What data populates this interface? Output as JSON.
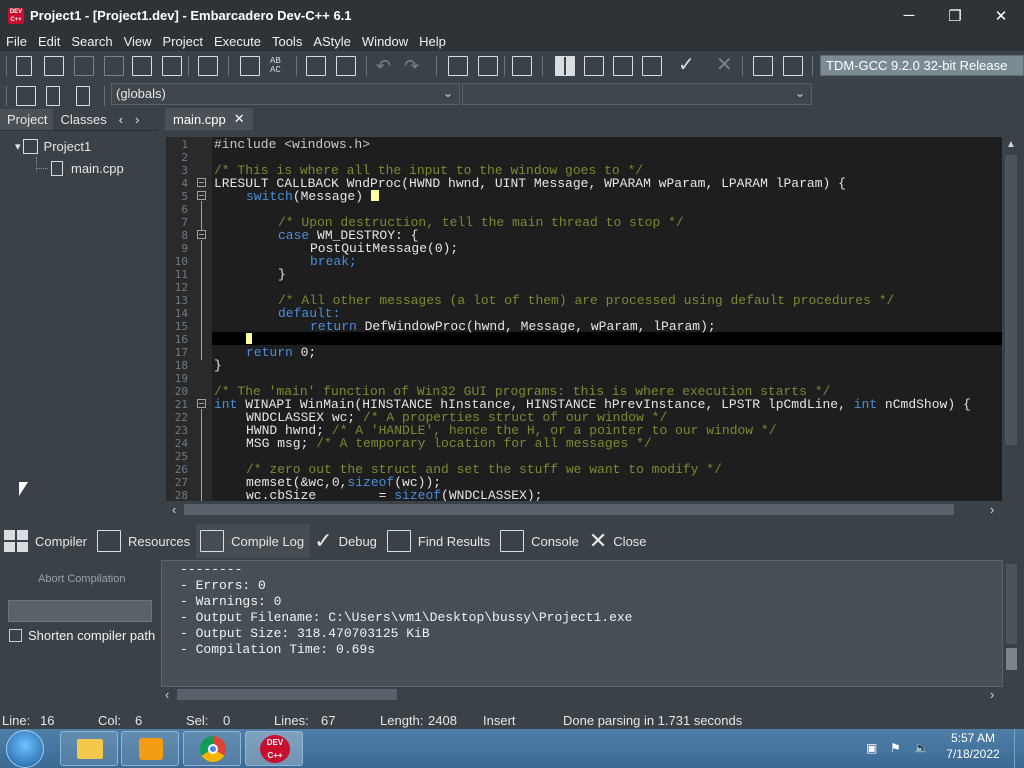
{
  "window": {
    "title": "Project1 - [Project1.dev] - Embarcadero Dev-C++ 6.1",
    "app_icon_text": "DEV C++",
    "minimize": "─",
    "maximize": "❐",
    "close": "✕"
  },
  "menu": [
    "File",
    "Edit",
    "Search",
    "View",
    "Project",
    "Execute",
    "Tools",
    "AStyle",
    "Window",
    "Help"
  ],
  "toolbar": {
    "compiler": "TDM-GCC 9.2.0 32-bit Release",
    "replace_icon_text": "AB AC"
  },
  "scope_combo": {
    "value": "(globals)",
    "arrow": "⌄"
  },
  "function_combo": {
    "value": "",
    "arrow": "⌄"
  },
  "left_panel": {
    "tabs": [
      "Project",
      "Classes"
    ],
    "nav_prev": "‹",
    "nav_next": "›",
    "tree": {
      "project": "Project1",
      "file": "main.cpp",
      "expander": "▾"
    }
  },
  "editor": {
    "tab": "main.cpp",
    "tab_close": "✕",
    "line_numbers": [
      "1",
      "2",
      "3",
      "4",
      "5",
      "6",
      "7",
      "8",
      "9",
      "10",
      "11",
      "12",
      "13",
      "14",
      "15",
      "16",
      "17",
      "18",
      "19",
      "20",
      "21",
      "22",
      "23",
      "24",
      "25",
      "26",
      "27",
      "28"
    ],
    "code": {
      "l1": "#include <windows.h>",
      "l3": "/* This is where all the input to the window goes to */",
      "l4": "LRESULT CALLBACK WndProc(HWND hwnd, UINT Message, WPARAM wParam, LPARAM lParam) {",
      "l5_kw": "switch",
      "l5_rest": "(Message) ",
      "l7": "/* Upon destruction, tell the main thread to stop */",
      "l8_kw": "case",
      "l8_rest": " WM_DESTROY: {",
      "l9": "PostQuitMessage(0);",
      "l10": "break;",
      "l11": "}",
      "l13": "/* All other messages (a lot of them) are processed using default procedures */",
      "l14": "default:",
      "l15_kw": "return",
      "l15_rest": " DefWindowProc(hwnd, Message, wParam, lParam);",
      "l17_kw": "return",
      "l17_rest": " 0;",
      "l18": "}",
      "l20": "/* The 'main' function of Win32 GUI programs: this is where execution starts */",
      "l21_kw": "int",
      "l21_mid": " WINAPI WinMain(HINSTANCE hInstance, HINSTANCE hPrevInstance, LPSTR lpCmdLine, ",
      "l21_kw2": "int",
      "l21_end": " nCmdShow) {",
      "l22_code": "WNDCLASSEX wc; ",
      "l22_cm": "/* A properties struct of our window */",
      "l23_code": "HWND hwnd; ",
      "l23_cm": "/* A 'HANDLE', hence the H, or a pointer to our window */",
      "l24_code": "MSG msg; ",
      "l24_cm": "/* A temporary location for all messages */",
      "l26": "/* zero out the struct and set the stuff we want to modify */",
      "l27_a": "memset(&wc,0,",
      "l27_kw": "sizeof",
      "l27_b": "(wc));",
      "l28_a": "wc.cbSize        = ",
      "l28_kw": "sizeof",
      "l28_b": "(WNDCLASSEX);"
    }
  },
  "scroll": {
    "up": "▲",
    "down": "▼",
    "left": "‹",
    "right": "›"
  },
  "bottom_tabs": [
    "Compiler",
    "Resources",
    "Compile Log",
    "Debug",
    "Find Results",
    "Console",
    "Close"
  ],
  "bottom_icons": {
    "debug": "✓",
    "close": "✕"
  },
  "compile_panel": {
    "abort_label": "Abort Compilation",
    "shorten_label": "Shorten compiler path",
    "log": [
      "--------",
      "- Errors: 0",
      "- Warnings: 0",
      "- Output Filename: C:\\Users\\vm1\\Desktop\\bussy\\Project1.exe",
      "- Output Size: 318.470703125 KiB",
      "- Compilation Time: 0.69s"
    ]
  },
  "status": {
    "line_label": "Line:",
    "line": "16",
    "col_label": "Col:",
    "col": "6",
    "sel_label": "Sel:",
    "sel": "0",
    "lines_label": "Lines:",
    "lines": "67",
    "length_label": "Length:",
    "length": "2408",
    "mode": "Insert",
    "message": "Done parsing in 1.731 seconds"
  },
  "taskbar": {
    "time": "5:57 AM",
    "date": "7/18/2022",
    "devcpp_text": "DEV C++"
  },
  "colors": {
    "comment": "#7a8a2e",
    "keyword": "#4a8edc",
    "editor_bg": "#1e1e1e",
    "compiler_select_bg": "#7c8a94"
  }
}
